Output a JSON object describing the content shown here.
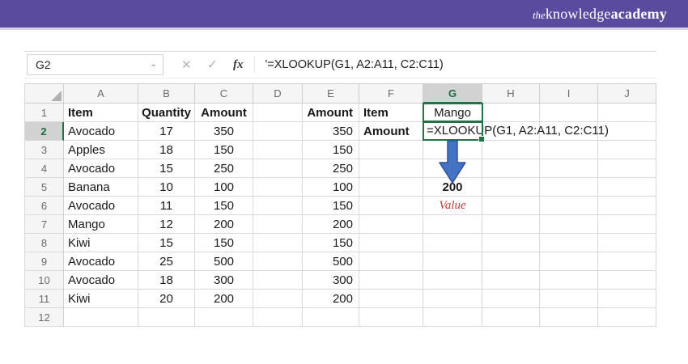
{
  "brand": {
    "logo": {
      "the": "the",
      "knowledge": "knowledge",
      "academy": "academy"
    },
    "bar_color": "#5b4b9e"
  },
  "formula_bar": {
    "name_box_value": "G2",
    "dropdown_icon": "⌄",
    "cancel_icon": "✕",
    "enter_icon": "✓",
    "fx_icon": "fx",
    "formula_text": "'=XLOOKUP(G1, A2:A11, C2:C11)"
  },
  "sheet": {
    "column_headers": [
      "A",
      "B",
      "C",
      "D",
      "E",
      "F",
      "G",
      "H",
      "I",
      "J"
    ],
    "selected_column": "G",
    "selected_row": "2",
    "active_cell": {
      "ref": "G2",
      "display_text": "=XLOOKUP(G1, A2:A11, C2:C11)"
    },
    "lookup_cell": {
      "ref": "G1",
      "value": "Mango"
    },
    "result": {
      "value": "200",
      "label": "Value"
    },
    "rows": [
      {
        "n": "1",
        "A": "Item",
        "B": "Quantity",
        "C": "Amount",
        "D": "",
        "E": "Amount",
        "F": "Item",
        "G": "Mango",
        "H": "",
        "I": "",
        "J": ""
      },
      {
        "n": "2",
        "A": "Avocado",
        "B": "17",
        "C": "350",
        "D": "",
        "E": "350",
        "F": "Amount",
        "G": "",
        "H": "",
        "I": "",
        "J": ""
      },
      {
        "n": "3",
        "A": "Apples",
        "B": "18",
        "C": "150",
        "D": "",
        "E": "150",
        "F": "",
        "G": "",
        "H": "",
        "I": "",
        "J": ""
      },
      {
        "n": "4",
        "A": "Avocado",
        "B": "15",
        "C": "250",
        "D": "",
        "E": "250",
        "F": "",
        "G": "",
        "H": "",
        "I": "",
        "J": ""
      },
      {
        "n": "5",
        "A": "Banana",
        "B": "10",
        "C": "100",
        "D": "",
        "E": "100",
        "F": "",
        "G": "200",
        "H": "",
        "I": "",
        "J": ""
      },
      {
        "n": "6",
        "A": "Avocado",
        "B": "11",
        "C": "150",
        "D": "",
        "E": "150",
        "F": "",
        "G": "Value",
        "H": "",
        "I": "",
        "J": ""
      },
      {
        "n": "7",
        "A": "Mango",
        "B": "12",
        "C": "200",
        "D": "",
        "E": "200",
        "F": "",
        "G": "",
        "H": "",
        "I": "",
        "J": ""
      },
      {
        "n": "8",
        "A": "Kiwi",
        "B": "15",
        "C": "150",
        "D": "",
        "E": "150",
        "F": "",
        "G": "",
        "H": "",
        "I": "",
        "J": ""
      },
      {
        "n": "9",
        "A": "Avocado",
        "B": "25",
        "C": "500",
        "D": "",
        "E": "500",
        "F": "",
        "G": "",
        "H": "",
        "I": "",
        "J": ""
      },
      {
        "n": "10",
        "A": "Avocado",
        "B": "18",
        "C": "300",
        "D": "",
        "E": "300",
        "F": "",
        "G": "",
        "H": "",
        "I": "",
        "J": ""
      },
      {
        "n": "11",
        "A": "Kiwi",
        "B": "20",
        "C": "200",
        "D": "",
        "E": "200",
        "F": "",
        "G": "",
        "H": "",
        "I": "",
        "J": ""
      },
      {
        "n": "12",
        "A": "",
        "B": "",
        "C": "",
        "D": "",
        "E": "",
        "F": "",
        "G": "",
        "H": "",
        "I": "",
        "J": ""
      }
    ]
  },
  "colors": {
    "brand_purple": "#5b4b9e",
    "excel_green": "#217346",
    "selection_gray": "#d2d2d2",
    "gridline": "#d9d9d9",
    "arrow_blue": "#4472c4",
    "arrow_outline": "#2f5496",
    "value_red": "#bf3b3b"
  }
}
